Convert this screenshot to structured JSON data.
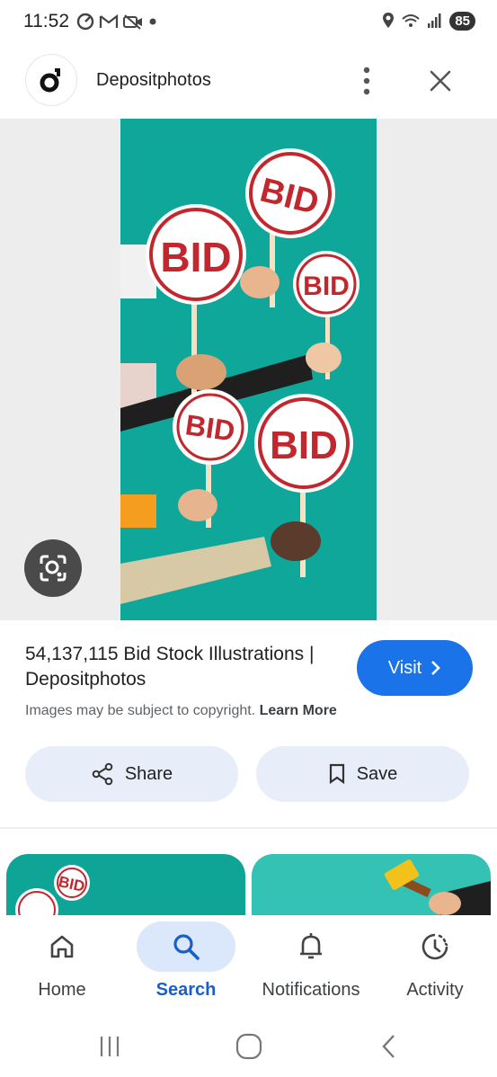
{
  "status_bar": {
    "time": "11:52",
    "battery": "85",
    "left_icons": [
      "sync-icon",
      "gmail-icon",
      "video-off-icon",
      "dot-icon"
    ],
    "right_icons": [
      "location-icon",
      "wifi-icon",
      "signal-icon"
    ]
  },
  "header": {
    "site_name": "Depositphotos",
    "logo_letter": "d"
  },
  "image": {
    "signs": [
      "BID",
      "BID",
      "BID",
      "BID",
      "BID"
    ]
  },
  "result": {
    "title": "54,137,115 Bid Stock Illustrations | Depositphotos",
    "copyright_text": "Images may be subject to copyright.",
    "learn_more": "Learn More",
    "visit_label": "Visit"
  },
  "actions": {
    "share_label": "Share",
    "save_label": "Save"
  },
  "related": {
    "thumb1_sign": "BID"
  },
  "bottom_nav": {
    "items": [
      {
        "label": "Home",
        "icon": "home-icon"
      },
      {
        "label": "Search",
        "icon": "search-icon"
      },
      {
        "label": "Notifications",
        "icon": "bell-icon"
      },
      {
        "label": "Activity",
        "icon": "activity-icon"
      }
    ],
    "active": "Search"
  },
  "colors": {
    "accent": "#1a73e8",
    "image_bg": "#0ea79a",
    "pill_bg": "#e8eef9",
    "active_nav_bg": "#dbe7fb"
  }
}
